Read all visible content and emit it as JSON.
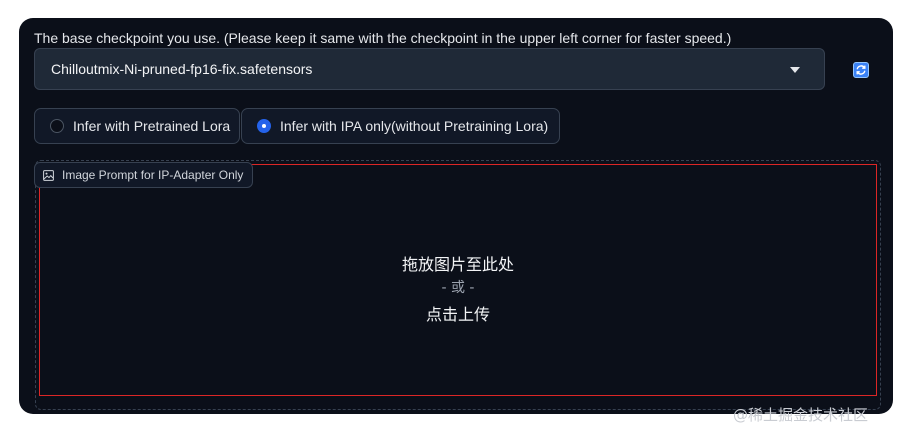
{
  "checkpoint": {
    "label": "The base checkpoint you use. (Please keep it same with the checkpoint in the upper left corner for faster speed.)",
    "selected": "Chilloutmix-Ni-pruned-fp16-fix.safetensors"
  },
  "mode": {
    "options": [
      {
        "label": "Infer with Pretrained Lora",
        "checked": false
      },
      {
        "label": "Infer with IPA only(without Pretraining Lora)",
        "checked": true
      }
    ]
  },
  "image_prompt": {
    "label": "Image Prompt for IP-Adapter Only",
    "drop_text": "拖放图片至此处",
    "or_text": "- 或 -",
    "click_text": "点击上传"
  },
  "watermark": "@稀土掘金技术社区",
  "colors": {
    "panel_bg": "#0b0f19",
    "accent": "#2563eb",
    "dropzone_border": "#dc2626"
  }
}
